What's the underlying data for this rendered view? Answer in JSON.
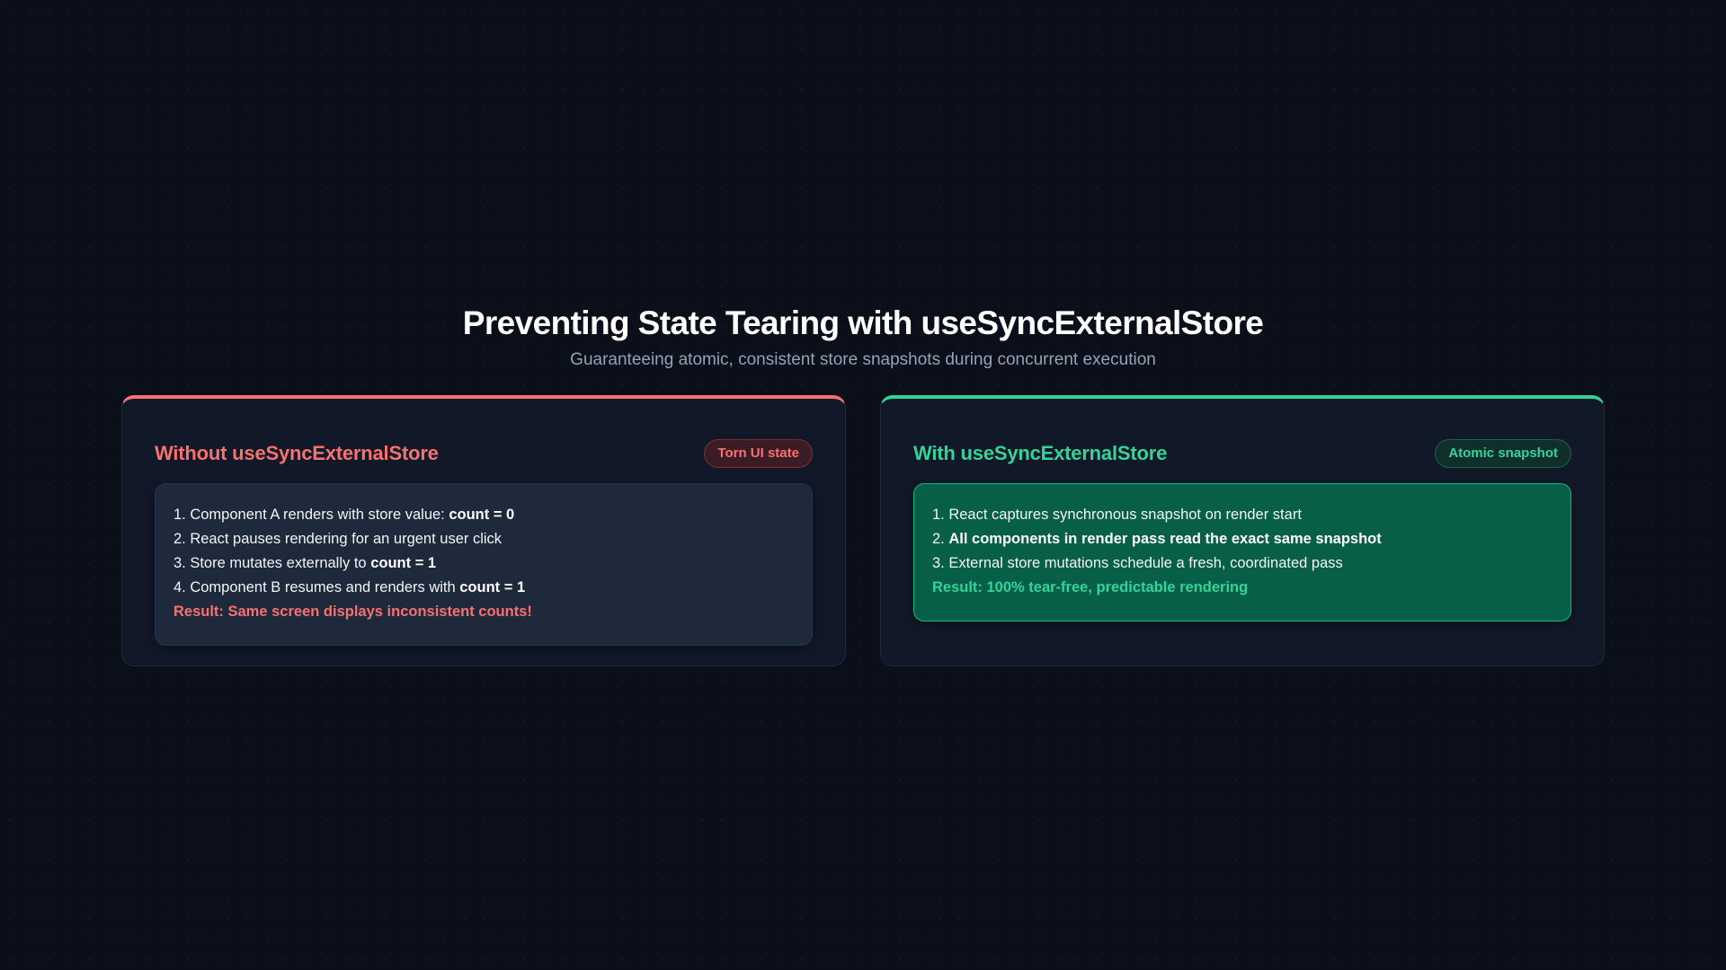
{
  "header": {
    "title": "Preventing State Tearing with useSyncExternalStore",
    "subtitle": "Guaranteeing atomic, consistent store snapshots during concurrent execution"
  },
  "colors": {
    "background": "#0b0f19",
    "card": "#111827",
    "bad_accent": "#f87171",
    "good_accent": "#34d399",
    "bad_panel": "#1e293b",
    "good_panel": "#065f46"
  },
  "without": {
    "title": "Without useSyncExternalStore",
    "badge": "Torn UI state",
    "steps": [
      {
        "text": "1. Component A renders with store value: ",
        "bold": "count = 0"
      },
      {
        "text": "2. React pauses rendering for an urgent user click",
        "bold": ""
      },
      {
        "text": "3. Store mutates externally to ",
        "bold": "count = 1"
      },
      {
        "text": "4. Component B resumes and renders with ",
        "bold": "count = 1"
      }
    ],
    "result": "Result: Same screen displays inconsistent counts!"
  },
  "with": {
    "title": "With useSyncExternalStore",
    "badge": "Atomic snapshot",
    "steps": [
      {
        "text": "1. React captures synchronous snapshot on render start",
        "bold": ""
      },
      {
        "text": "2. ",
        "bold": "All components in render pass read the exact same snapshot"
      },
      {
        "text": "3. External store mutations schedule a fresh, coordinated pass",
        "bold": ""
      }
    ],
    "result": "Result: 100% tear-free, predictable rendering"
  }
}
